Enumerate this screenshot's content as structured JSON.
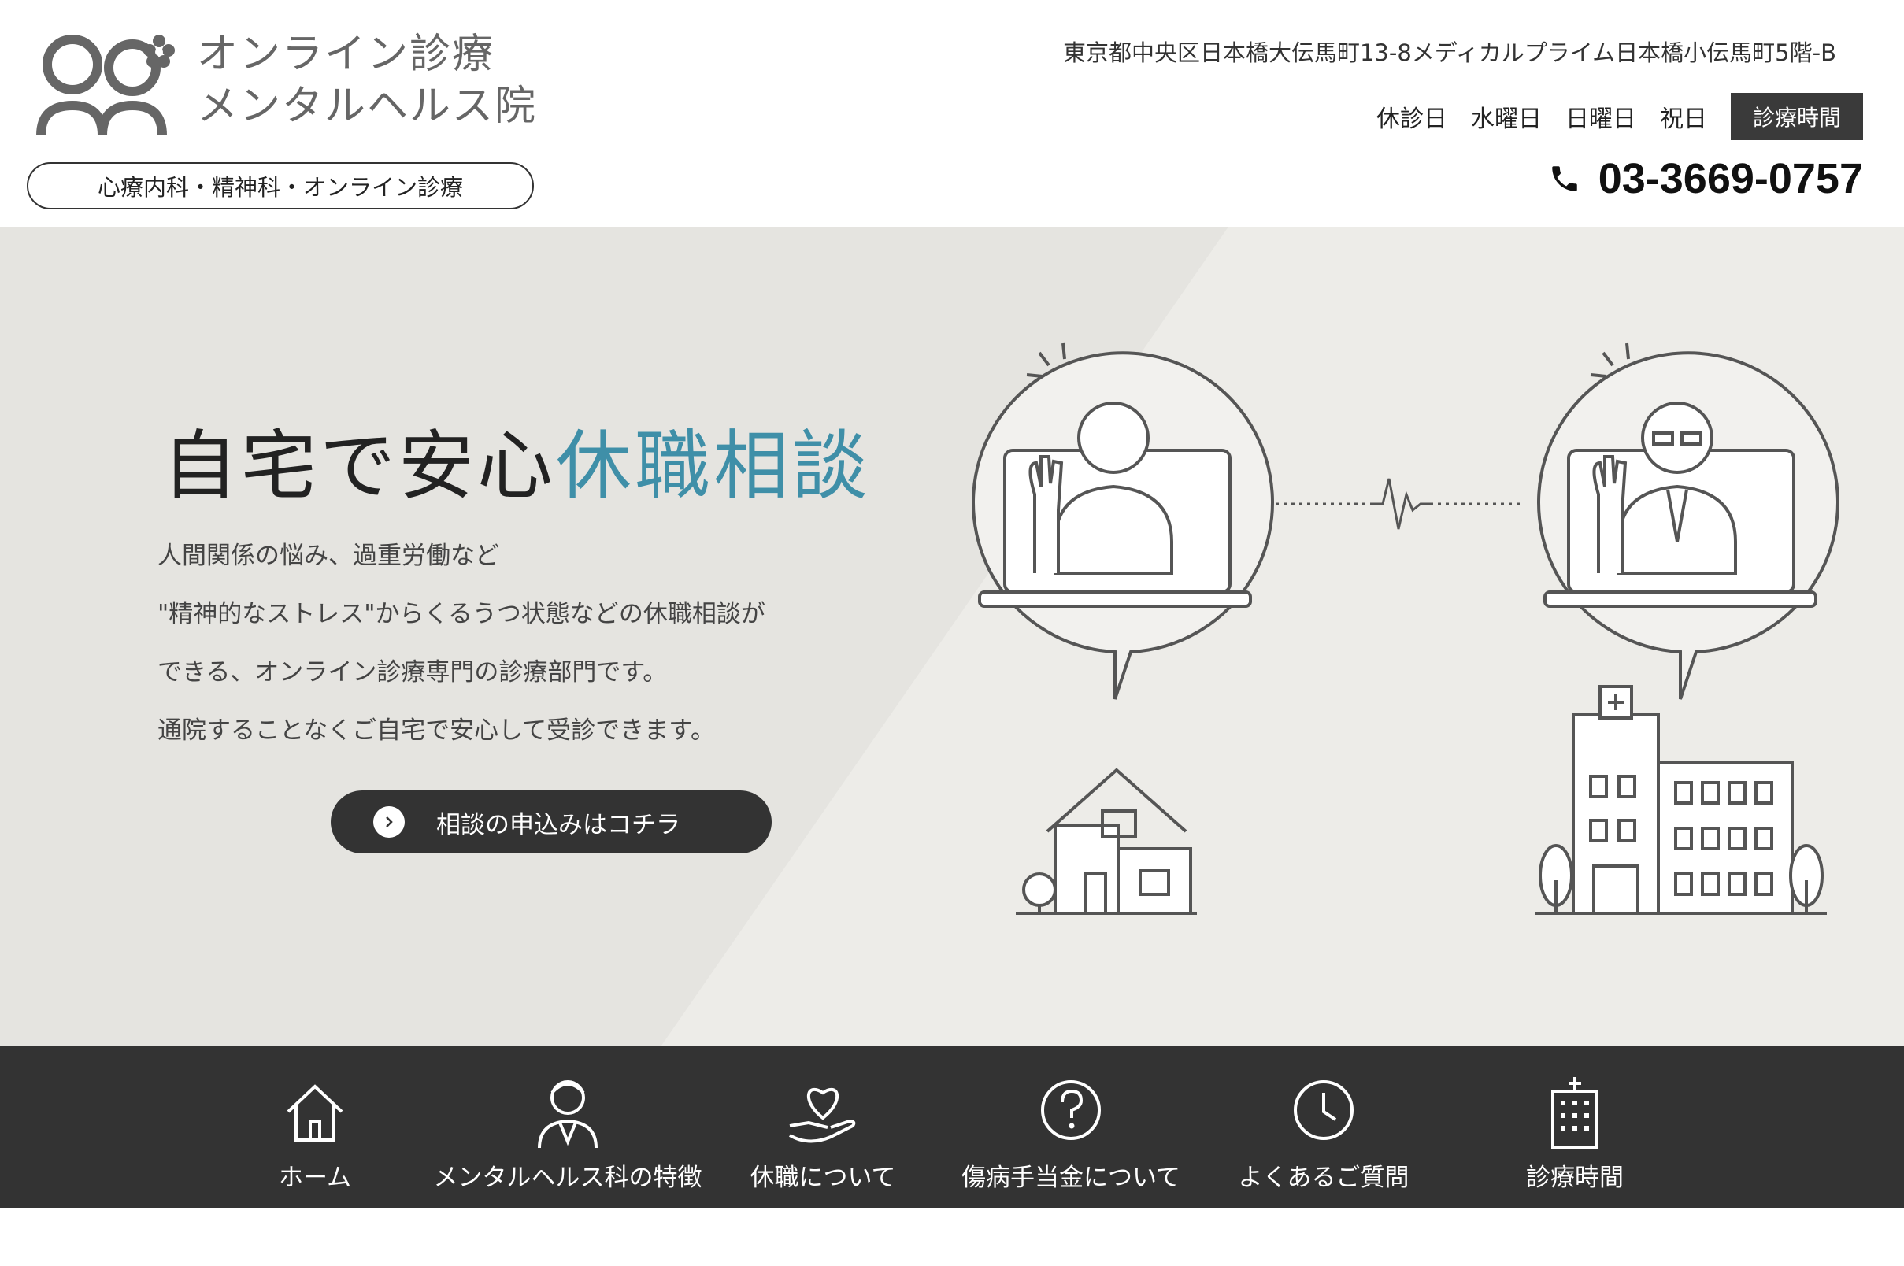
{
  "header": {
    "logo_line1": "オンライン診療",
    "logo_line2": "メンタルヘルス院",
    "dept": "心療内科・精神科・オンライン診療",
    "address": "東京都中央区日本橋大伝馬町13-8メディカルプライム日本橋小伝馬町5階-B",
    "closed_label": "休診日",
    "closed_days": [
      "水曜日",
      "日曜日",
      "祝日"
    ],
    "hours_button": "診療時間",
    "phone": "03-3669-0757"
  },
  "hero": {
    "title_main": "自宅で安心",
    "title_accent": "休職相談",
    "lines": [
      "人間関係の悩み、過重労働など",
      "\"精神的なストレス\"からくるうつ状態などの休職相談が",
      "できる、オンライン診療専門の診療部門です。",
      "通院することなくご自宅で安心して受診できます。"
    ],
    "cta_label": "相談の申込みはコチラ"
  },
  "nav": {
    "items": [
      {
        "label": "ホーム",
        "icon": "home-icon"
      },
      {
        "label": "メンタルヘルス科の特徴",
        "icon": "doctor-icon"
      },
      {
        "label": "休職について",
        "icon": "heart-hand-icon"
      },
      {
        "label": "傷病手当金について",
        "icon": "question-bubble-icon"
      },
      {
        "label": "よくあるご質問",
        "icon": "clock-icon"
      },
      {
        "label": "診療時間",
        "icon": "hospital-icon"
      }
    ]
  },
  "colors": {
    "accent": "#3f8fa8",
    "dark": "#333333",
    "hero_bg": "#e5e4e0"
  }
}
